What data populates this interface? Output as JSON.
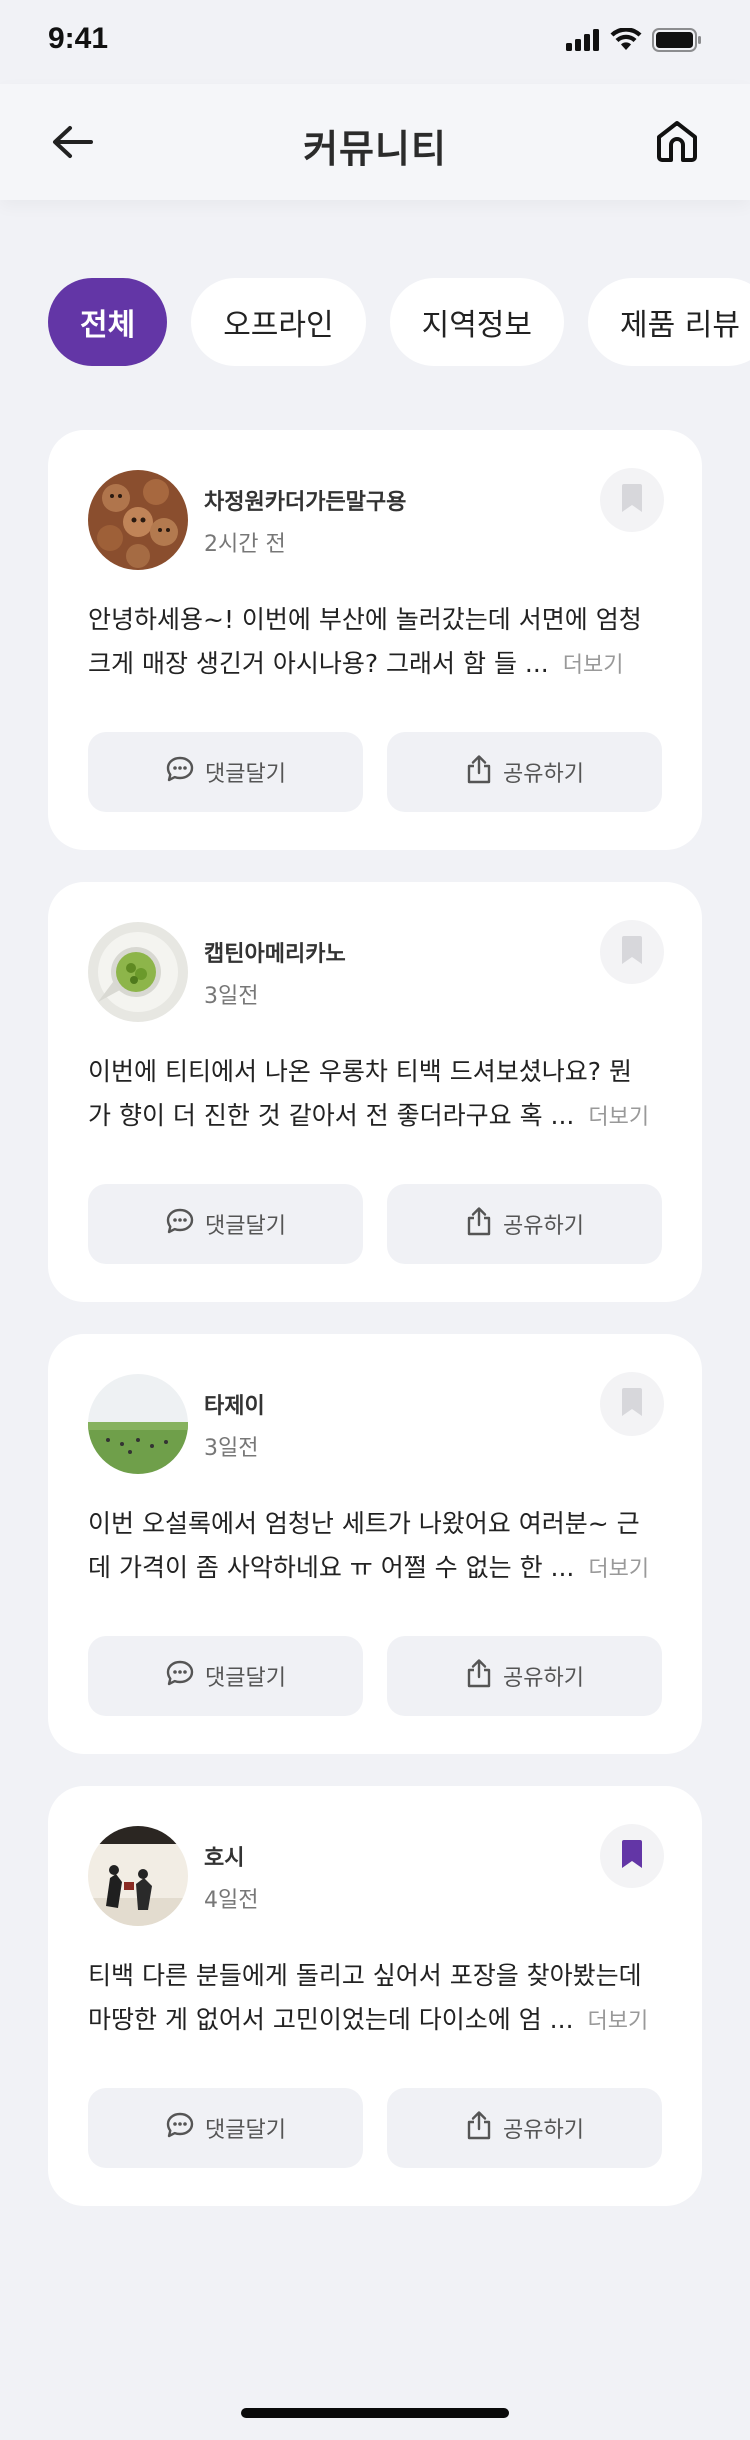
{
  "status": {
    "time": "9:41"
  },
  "header": {
    "title": "커뮤니티"
  },
  "tabs": [
    {
      "label": "전체",
      "active": true
    },
    {
      "label": "오프라인",
      "active": false
    },
    {
      "label": "지역정보",
      "active": false
    },
    {
      "label": "제품 리뷰",
      "active": false
    }
  ],
  "posts": [
    {
      "author": "차정원카더가든말구용",
      "time": "2시간 전",
      "line1": "안녕하세용~! 이번에 부산에 놀러갔는데 서면에 엄청",
      "line2": "크게 매장 생긴거 아시나용? 그래서 함 들 ...",
      "more": "더보기",
      "comment": "댓글달기",
      "share": "공유하기",
      "bookmarked": false
    },
    {
      "author": "캡틴아메리카노",
      "time": "3일전",
      "line1": "이번에 티티에서 나온 우롱차 티백 드셔보셨나요? 뭔",
      "line2": "가 향이 더 진한 것 같아서 전 좋더라구요 혹 ...",
      "more": "더보기",
      "comment": "댓글달기",
      "share": "공유하기",
      "bookmarked": false
    },
    {
      "author": "타제이",
      "time": "3일전",
      "line1": "이번 오설록에서 엄청난 세트가 나왔어요 여러분~ 근",
      "line2": "데 가격이 좀 사악하네요 ㅠ 어쩔 수 없는 한 ...",
      "more": "더보기",
      "comment": "댓글달기",
      "share": "공유하기",
      "bookmarked": false
    },
    {
      "author": "호시",
      "time": "4일전",
      "line1": "티백 다른 분들에게 돌리고 싶어서 포장을 찾아봤는데",
      "line2": "마땅한 게 없어서 고민이었는데 다이소에 엄 ...",
      "more": "더보기",
      "comment": "댓글달기",
      "share": "공유하기",
      "bookmarked": true
    }
  ],
  "colors": {
    "accent": "#6336a6",
    "background": "#f1f2f6",
    "card": "#ffffff",
    "bookmark_inactive": "#d7d7db"
  }
}
